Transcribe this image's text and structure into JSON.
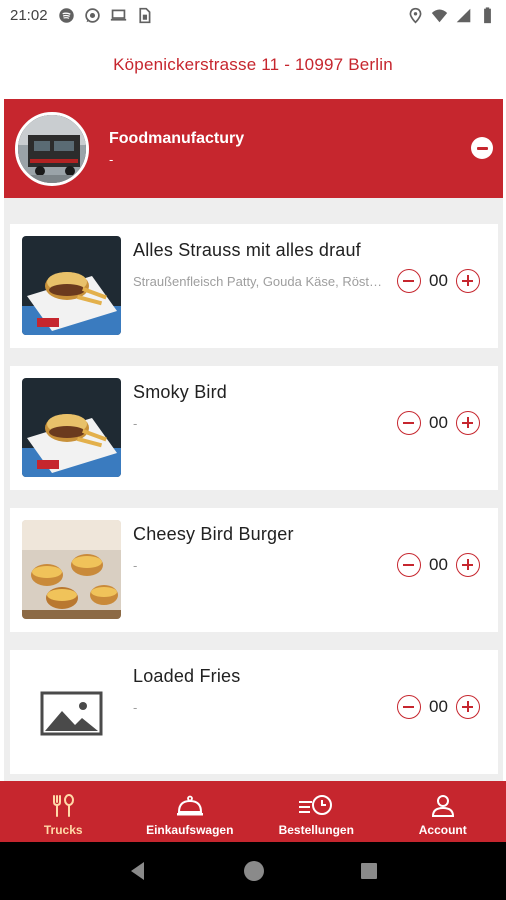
{
  "status_bar": {
    "time": "21:02",
    "left_icons": [
      "spotify-icon",
      "whatsapp-icon",
      "laptop-icon",
      "sim-card-icon"
    ],
    "right_icons": [
      "location-icon",
      "wifi-icon",
      "signal-icon",
      "battery-icon"
    ]
  },
  "address": "Köpenickerstrasse 11 - 10997 Berlin",
  "restaurant": {
    "name": "Foodmanufactury",
    "subtitle": "-"
  },
  "products": [
    {
      "title": "Alles Strauss mit alles drauf",
      "description": "Straußenfleisch Patty, Gouda Käse, Röstzwiebeln",
      "quantity": "00",
      "image": "burger-fries"
    },
    {
      "title": "Smoky Bird",
      "description": "-",
      "quantity": "00",
      "image": "burger-fries"
    },
    {
      "title": "Cheesy Bird Burger",
      "description": "-",
      "quantity": "00",
      "image": "burger-tray"
    },
    {
      "title": "Loaded Fries",
      "description": "-",
      "quantity": "00",
      "image": "placeholder"
    }
  ],
  "bottom_nav": {
    "items": [
      {
        "label": "Trucks",
        "icon": "fork-spoon-icon",
        "active": true
      },
      {
        "label": "Einkaufswagen",
        "icon": "cloche-icon",
        "active": false
      },
      {
        "label": "Bestellungen",
        "icon": "order-history-icon",
        "active": false
      },
      {
        "label": "Account",
        "icon": "user-icon",
        "active": false
      }
    ]
  },
  "colors": {
    "brand_red": "#c6262e",
    "active_nav": "#ffd9a8",
    "list_bg": "#eeeeee"
  }
}
